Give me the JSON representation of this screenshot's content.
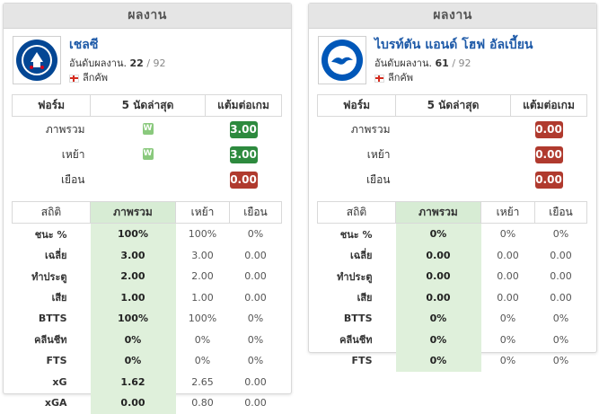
{
  "header_label": "ผลงาน",
  "teams": [
    {
      "name": "เชลซี",
      "rank_label": "อันดับผลงาน.",
      "rank": "22",
      "rank_total": "/ 92",
      "league": "ลีกคัพ",
      "logo": "chelsea-crest",
      "logo_text": "CHELSEA FOOTBALL CLUB",
      "form_headers": [
        "ฟอร์ม",
        "5 นัดล่าสุด",
        "แต้มต่อเกม"
      ],
      "form_rows": [
        {
          "label": "ภาพรวม",
          "results": [
            "W"
          ],
          "ppg": "3.00",
          "status": "good"
        },
        {
          "label": "เหย้า",
          "results": [
            "W"
          ],
          "ppg": "3.00",
          "status": "good"
        },
        {
          "label": "เยือน",
          "results": [],
          "ppg": "0.00",
          "status": "bad"
        }
      ],
      "stats_headers": [
        "สถิติ",
        "ภาพรวม",
        "เหย้า",
        "เยือน"
      ],
      "stats_rows": [
        {
          "label": "ชนะ %",
          "overall": "100%",
          "home": "100%",
          "away": "0%"
        },
        {
          "label": "เฉลี่ย",
          "overall": "3.00",
          "home": "3.00",
          "away": "0.00"
        },
        {
          "label": "ทำประตู",
          "overall": "2.00",
          "home": "2.00",
          "away": "0.00"
        },
        {
          "label": "เสีย",
          "overall": "1.00",
          "home": "1.00",
          "away": "0.00"
        },
        {
          "label": "BTTS",
          "overall": "100%",
          "home": "100%",
          "away": "0%"
        },
        {
          "label": "คลีนชีท",
          "overall": "0%",
          "home": "0%",
          "away": "0%"
        },
        {
          "label": "FTS",
          "overall": "0%",
          "home": "0%",
          "away": "0%"
        },
        {
          "label": "xG",
          "overall": "1.62",
          "home": "2.65",
          "away": "0.00"
        },
        {
          "label": "xGA",
          "overall": "0.00",
          "home": "0.80",
          "away": "0.00"
        }
      ]
    },
    {
      "name": "ไบรท์ตัน แอนด์ โฮฟ อัลเบี้ยน",
      "rank_label": "อันดับผลงาน.",
      "rank": "61",
      "rank_total": "/ 92",
      "league": "ลีกคัพ",
      "logo": "brighton-crest",
      "logo_text": "BRIGHTON & HOVE ALBION",
      "form_headers": [
        "ฟอร์ม",
        "5 นัดล่าสุด",
        "แต้มต่อเกม"
      ],
      "form_rows": [
        {
          "label": "ภาพรวม",
          "results": [],
          "ppg": "0.00",
          "status": "bad"
        },
        {
          "label": "เหย้า",
          "results": [],
          "ppg": "0.00",
          "status": "bad"
        },
        {
          "label": "เยือน",
          "results": [],
          "ppg": "0.00",
          "status": "bad"
        }
      ],
      "stats_headers": [
        "สถิติ",
        "ภาพรวม",
        "เหย้า",
        "เยือน"
      ],
      "stats_rows": [
        {
          "label": "ชนะ %",
          "overall": "0%",
          "home": "0%",
          "away": "0%"
        },
        {
          "label": "เฉลี่ย",
          "overall": "0.00",
          "home": "0.00",
          "away": "0.00"
        },
        {
          "label": "ทำประตู",
          "overall": "0.00",
          "home": "0.00",
          "away": "0.00"
        },
        {
          "label": "เสีย",
          "overall": "0.00",
          "home": "0.00",
          "away": "0.00"
        },
        {
          "label": "BTTS",
          "overall": "0%",
          "home": "0%",
          "away": "0%"
        },
        {
          "label": "คลีนชีท",
          "overall": "0%",
          "home": "0%",
          "away": "0%"
        },
        {
          "label": "FTS",
          "overall": "0%",
          "home": "0%",
          "away": "0%"
        }
      ]
    }
  ],
  "colors": {
    "team_link": "#1e5aa8",
    "ppg_good": "#2d8a3e",
    "ppg_bad": "#b03a2e",
    "win_badge": "#8ac97d",
    "highlight_column": "#dff0db"
  }
}
